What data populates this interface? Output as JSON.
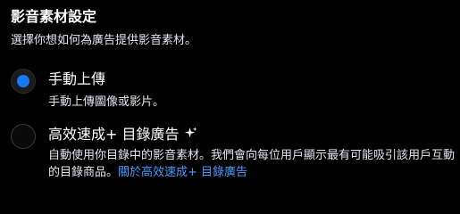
{
  "colors": {
    "accent": "#1877f2",
    "link": "#4599ff"
  },
  "header": {
    "title": "影音素材設定",
    "subtitle": "選擇你想如何為廣告提供影音素材。"
  },
  "options": [
    {
      "label": "手動上傳",
      "description": "手動上傳圖像或影片。",
      "selected": true
    },
    {
      "label": "高效速成+ 目錄廣告",
      "icon": "sparkle-icon",
      "description": "自動使用你目錄中的影音素材。我們會向每位用戶顯示最有可能吸引該用戶互動的目錄商品。",
      "link_text": "關於高效速成+ 目錄廣告",
      "selected": false
    }
  ]
}
